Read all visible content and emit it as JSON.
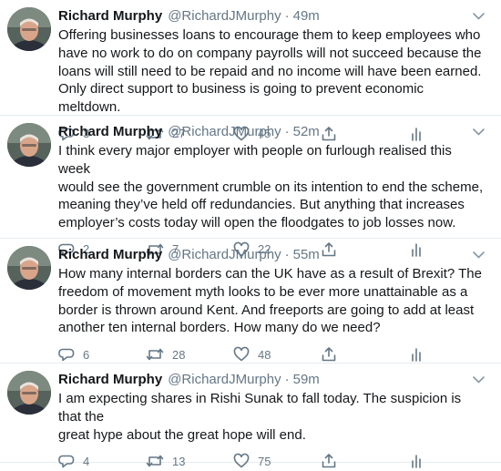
{
  "tweets": [
    {
      "author": "Richard Murphy",
      "handle": "@RichardJMurphy",
      "separator": "·",
      "time": "49m",
      "text": "Offering businesses loans to encourage them to keep employees who\nhave no work to do on company payrolls will not succeed because the\nloans will still need to be repaid and no income will have been earned.\nOnly direct support to business is going to prevent economic meltdown.",
      "replies": "3",
      "retweets": "27",
      "likes": "45"
    },
    {
      "author": "Richard Murphy",
      "handle": "@RichardJMurphy",
      "separator": "·",
      "time": "52m",
      "text": "I think every major employer with people on furlough realised this week\nwould see the government crumble on its intention to end the scheme,\nmeaning they’ve held off redundancies. But anything that increases\nemployer’s costs today will open the floodgates to job losses now.",
      "replies": "2",
      "retweets": "7",
      "likes": "22"
    },
    {
      "author": "Richard Murphy",
      "handle": "@RichardJMurphy",
      "separator": "·",
      "time": "55m",
      "text": "How many internal borders can the UK have as a result of Brexit? The\nfreedom of movement myth looks to be ever more unattainable as a\nborder is thrown around Kent. And freeports are going to add at least\nanother ten internal borders. How many do we need?",
      "replies": "6",
      "retweets": "28",
      "likes": "48"
    },
    {
      "author": "Richard Murphy",
      "handle": "@RichardJMurphy",
      "separator": "·",
      "time": "59m",
      "text": "I am expecting shares in Rishi Sunak to fall today. The suspicion is that the\ngreat hype about the great hope will end.",
      "replies": "4",
      "retweets": "13",
      "likes": "75"
    }
  ],
  "icons": {
    "caret": "chevron-down-icon",
    "reply": "reply-icon",
    "retweet": "retweet-icon",
    "like": "like-icon",
    "share": "share-icon",
    "analytics": "analytics-icon"
  },
  "colors": {
    "text": "#14171a",
    "secondary": "#657786",
    "divider": "#e6ecf0"
  }
}
